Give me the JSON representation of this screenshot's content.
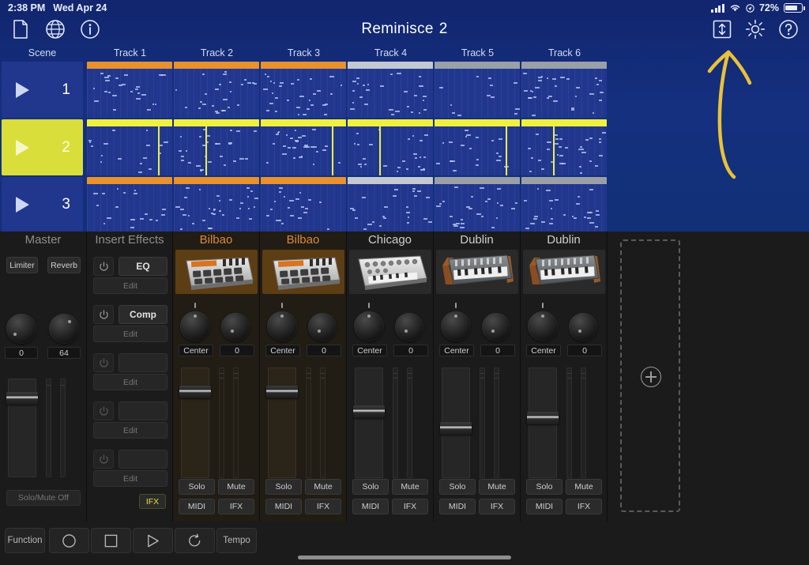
{
  "status_bar": {
    "time": "2:38 PM",
    "date": "Wed Apr 24",
    "battery_percent": "72%",
    "battery_level": 72,
    "icons": [
      "signal-icon",
      "wifi-icon",
      "location-icon",
      "battery-icon"
    ]
  },
  "header": {
    "title": "Reminisce",
    "title_number": "2",
    "left_icons": [
      "file-icon",
      "globe-icon",
      "info-icon"
    ],
    "right_icons": [
      "share-export-icon",
      "gear-icon",
      "help-icon"
    ]
  },
  "annotation": {
    "arrow_color": "#e8c23a",
    "points_to": "share-export-icon"
  },
  "grid": {
    "scene_column_label": "Scene",
    "track_labels": [
      "Track 1",
      "Track 2",
      "Track 3",
      "Track 4",
      "Track 5",
      "Track 6"
    ],
    "scenes": [
      {
        "number": "1",
        "active": false
      },
      {
        "number": "2",
        "active": true
      },
      {
        "number": "3",
        "active": false
      }
    ],
    "clip_header_colors": {
      "orange": "#e8912e",
      "light_gray": "#c3c9d2",
      "gray": "#9aa0a8",
      "active_yellow": "#f0f13f"
    },
    "clip_rows": [
      {
        "scene": "1",
        "headers": [
          "orange",
          "orange",
          "orange",
          "light_gray",
          "gray",
          "gray"
        ]
      },
      {
        "scene": "2",
        "headers": [
          "active_yellow",
          "active_yellow",
          "active_yellow",
          "active_yellow",
          "active_yellow",
          "active_yellow"
        ]
      },
      {
        "scene": "3",
        "headers": [
          "orange",
          "orange",
          "orange",
          "light_gray",
          "gray",
          "gray"
        ]
      }
    ]
  },
  "master": {
    "title": "Master",
    "limiter_label": "Limiter",
    "reverb_label": "Reverb",
    "knob_values": [
      "0",
      "64"
    ],
    "solo_mute_label": "Solo/Mute Off"
  },
  "insert_effects": {
    "title": "Insert Effects",
    "ifx_label": "IFX",
    "edit_label": "Edit",
    "power_icon": "power-icon",
    "slots": [
      {
        "name": "EQ",
        "enabled": true
      },
      {
        "name": "Comp",
        "enabled": true
      },
      {
        "name": "",
        "enabled": false
      },
      {
        "name": "",
        "enabled": false
      },
      {
        "name": "",
        "enabled": false
      }
    ]
  },
  "tracks": [
    {
      "name": "Bilbao",
      "color": "orange",
      "device": "drum-machine-device",
      "pan": "Center",
      "send": "0",
      "fader": 18,
      "solo": "Solo",
      "mute": "Mute",
      "midi": "MIDI",
      "ifx": "IFX"
    },
    {
      "name": "Bilbao",
      "color": "orange",
      "device": "drum-machine-device",
      "pan": "Center",
      "send": "0",
      "fader": 18,
      "solo": "Solo",
      "mute": "Mute",
      "midi": "MIDI",
      "ifx": "IFX"
    },
    {
      "name": "Chicago",
      "color": "white",
      "device": "analog-synth-device",
      "pan": "Center",
      "send": "0",
      "fader": 38,
      "solo": "Solo",
      "mute": "Mute",
      "midi": "MIDI",
      "ifx": "IFX"
    },
    {
      "name": "Dublin",
      "color": "white",
      "device": "wood-synth-device",
      "pan": "Center",
      "send": "0",
      "fader": 55,
      "solo": "Solo",
      "mute": "Mute",
      "midi": "MIDI",
      "ifx": "IFX"
    },
    {
      "name": "Dublin",
      "color": "white",
      "device": "wood-synth-device",
      "pan": "Center",
      "send": "0",
      "fader": 44,
      "solo": "Solo",
      "mute": "Mute",
      "midi": "MIDI",
      "ifx": "IFX"
    }
  ],
  "add_track": {
    "icon": "plus-icon"
  },
  "transport": {
    "function_label": "Function",
    "tempo_label": "Tempo",
    "buttons": [
      "record-icon",
      "stop-icon",
      "play-icon",
      "loop-icon"
    ]
  }
}
